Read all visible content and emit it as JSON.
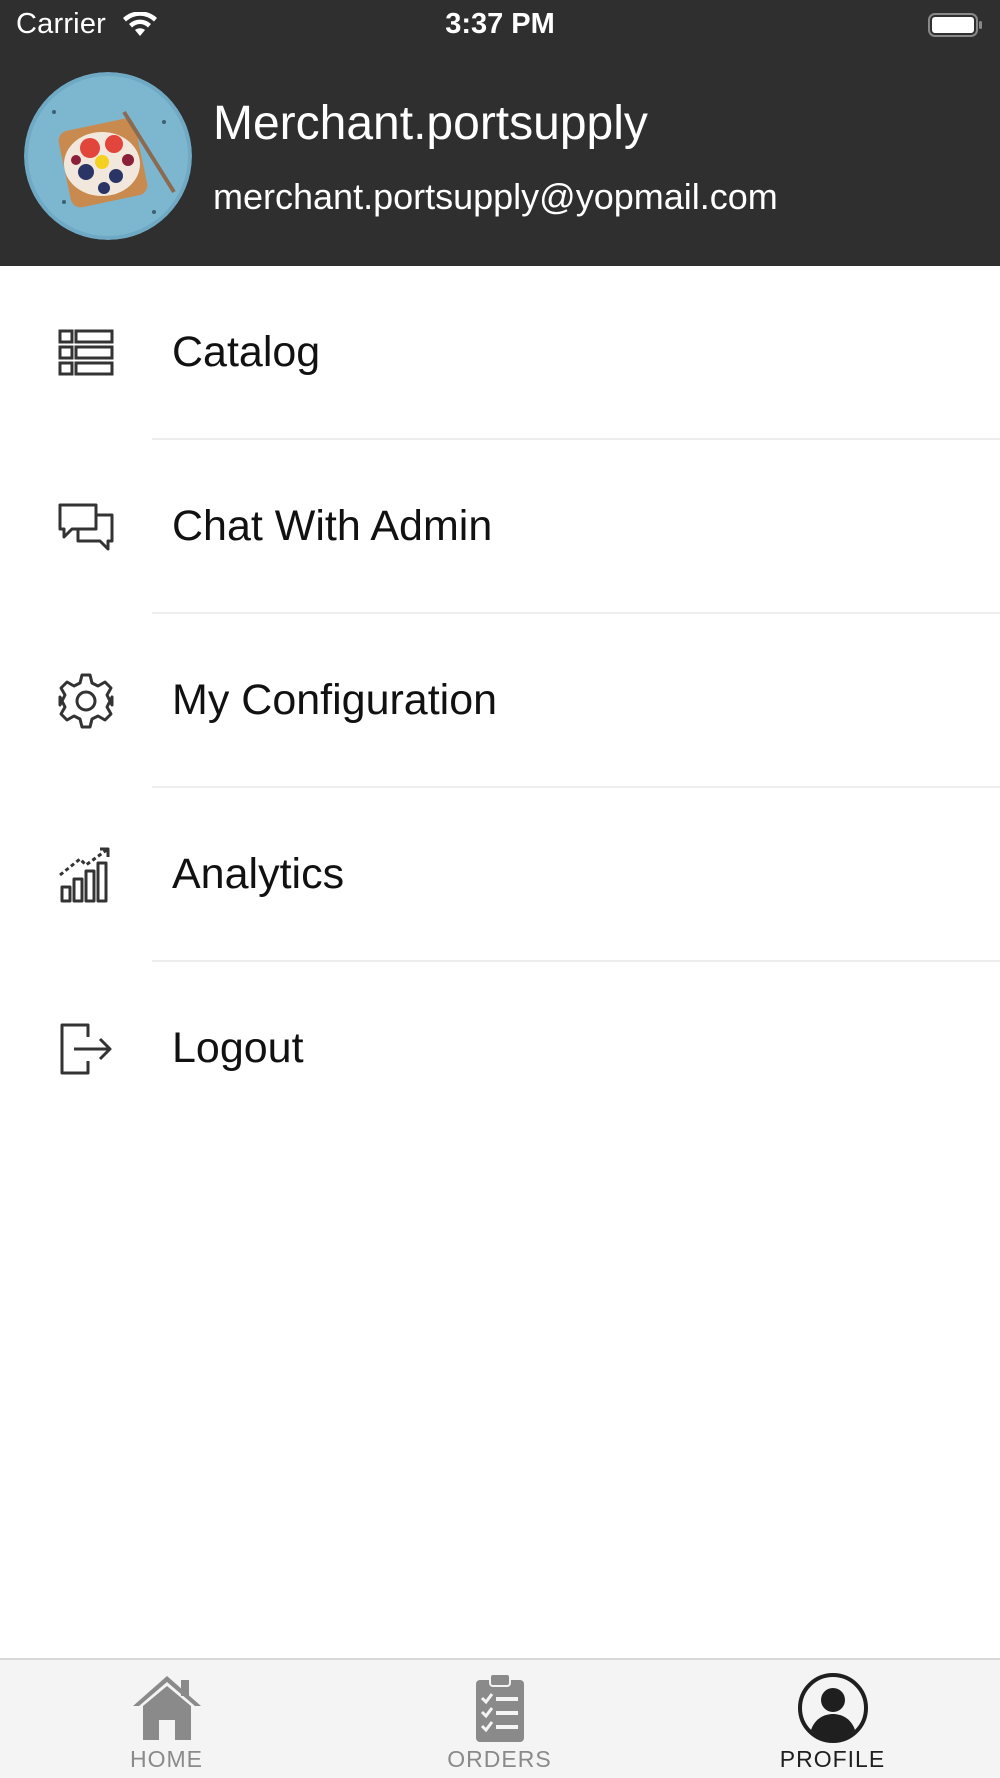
{
  "status_bar": {
    "carrier": "Carrier",
    "time": "3:37 PM"
  },
  "profile": {
    "name": "Merchant.portsupply",
    "email": "merchant.portsupply@yopmail.com"
  },
  "menu": {
    "items": [
      {
        "label": "Catalog",
        "icon": "list-icon"
      },
      {
        "label": "Chat With Admin",
        "icon": "chat-icon"
      },
      {
        "label": "My Configuration",
        "icon": "gear-icon"
      },
      {
        "label": "Analytics",
        "icon": "chart-icon"
      },
      {
        "label": "Logout",
        "icon": "logout-icon"
      }
    ]
  },
  "tab_bar": {
    "tabs": [
      {
        "label": "HOME",
        "icon": "home-icon",
        "active": false
      },
      {
        "label": "ORDERS",
        "icon": "clipboard-icon",
        "active": false
      },
      {
        "label": "PROFILE",
        "icon": "profile-icon",
        "active": true
      }
    ]
  },
  "colors": {
    "header_bg": "#2f2f2f",
    "tab_inactive": "#8a8a8a",
    "tab_active": "#1f1f1f"
  }
}
